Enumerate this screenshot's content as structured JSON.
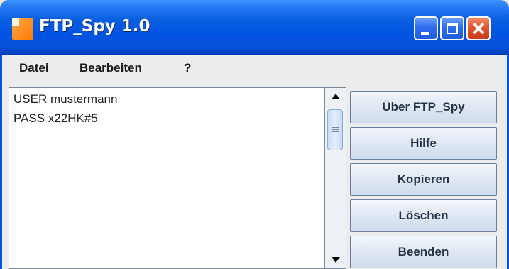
{
  "window": {
    "title": "FTP_Spy 1.0"
  },
  "menu": {
    "items": [
      "Datei",
      "Bearbeiten",
      "?"
    ]
  },
  "log": {
    "lines": [
      "USER mustermann",
      "PASS x22HK#5"
    ]
  },
  "buttons": [
    "Über FTP_Spy",
    "Hilfe",
    "Kopieren",
    "Löschen",
    "Beenden"
  ],
  "icons": {
    "app": "ftp-app-icon",
    "minimize": "minimize-icon",
    "maximize": "maximize-icon",
    "close": "close-icon"
  },
  "colors": {
    "titlebar": "#0054e3",
    "close_button": "#e1552f"
  }
}
